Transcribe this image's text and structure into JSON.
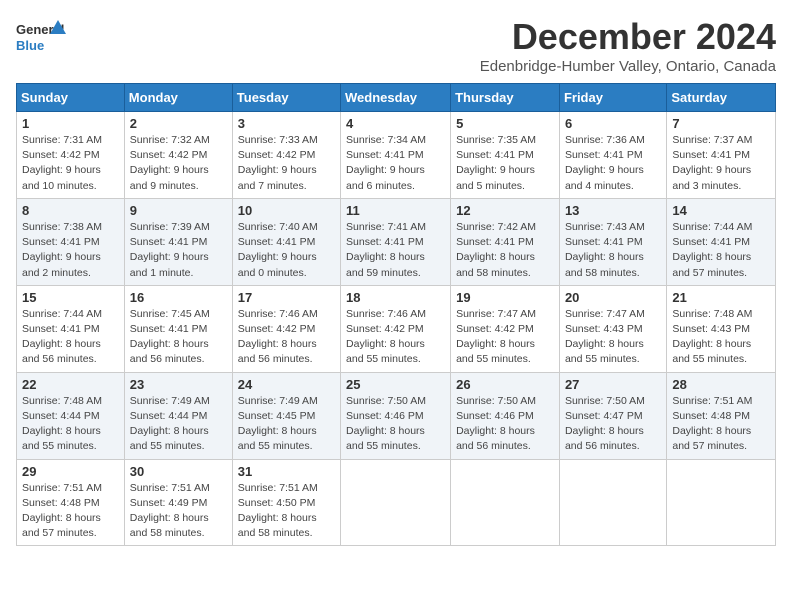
{
  "logo": {
    "line1": "General",
    "line2": "Blue"
  },
  "title": "December 2024",
  "location": "Edenbridge-Humber Valley, Ontario, Canada",
  "header": {
    "colors": {
      "accent": "#2b7dc2"
    }
  },
  "columns": [
    "Sunday",
    "Monday",
    "Tuesday",
    "Wednesday",
    "Thursday",
    "Friday",
    "Saturday"
  ],
  "weeks": [
    [
      {
        "day": "1",
        "detail": "Sunrise: 7:31 AM\nSunset: 4:42 PM\nDaylight: 9 hours and 10 minutes."
      },
      {
        "day": "2",
        "detail": "Sunrise: 7:32 AM\nSunset: 4:42 PM\nDaylight: 9 hours and 9 minutes."
      },
      {
        "day": "3",
        "detail": "Sunrise: 7:33 AM\nSunset: 4:42 PM\nDaylight: 9 hours and 7 minutes."
      },
      {
        "day": "4",
        "detail": "Sunrise: 7:34 AM\nSunset: 4:41 PM\nDaylight: 9 hours and 6 minutes."
      },
      {
        "day": "5",
        "detail": "Sunrise: 7:35 AM\nSunset: 4:41 PM\nDaylight: 9 hours and 5 minutes."
      },
      {
        "day": "6",
        "detail": "Sunrise: 7:36 AM\nSunset: 4:41 PM\nDaylight: 9 hours and 4 minutes."
      },
      {
        "day": "7",
        "detail": "Sunrise: 7:37 AM\nSunset: 4:41 PM\nDaylight: 9 hours and 3 minutes."
      }
    ],
    [
      {
        "day": "8",
        "detail": "Sunrise: 7:38 AM\nSunset: 4:41 PM\nDaylight: 9 hours and 2 minutes."
      },
      {
        "day": "9",
        "detail": "Sunrise: 7:39 AM\nSunset: 4:41 PM\nDaylight: 9 hours and 1 minute."
      },
      {
        "day": "10",
        "detail": "Sunrise: 7:40 AM\nSunset: 4:41 PM\nDaylight: 9 hours and 0 minutes."
      },
      {
        "day": "11",
        "detail": "Sunrise: 7:41 AM\nSunset: 4:41 PM\nDaylight: 8 hours and 59 minutes."
      },
      {
        "day": "12",
        "detail": "Sunrise: 7:42 AM\nSunset: 4:41 PM\nDaylight: 8 hours and 58 minutes."
      },
      {
        "day": "13",
        "detail": "Sunrise: 7:43 AM\nSunset: 4:41 PM\nDaylight: 8 hours and 58 minutes."
      },
      {
        "day": "14",
        "detail": "Sunrise: 7:44 AM\nSunset: 4:41 PM\nDaylight: 8 hours and 57 minutes."
      }
    ],
    [
      {
        "day": "15",
        "detail": "Sunrise: 7:44 AM\nSunset: 4:41 PM\nDaylight: 8 hours and 56 minutes."
      },
      {
        "day": "16",
        "detail": "Sunrise: 7:45 AM\nSunset: 4:41 PM\nDaylight: 8 hours and 56 minutes."
      },
      {
        "day": "17",
        "detail": "Sunrise: 7:46 AM\nSunset: 4:42 PM\nDaylight: 8 hours and 56 minutes."
      },
      {
        "day": "18",
        "detail": "Sunrise: 7:46 AM\nSunset: 4:42 PM\nDaylight: 8 hours and 55 minutes."
      },
      {
        "day": "19",
        "detail": "Sunrise: 7:47 AM\nSunset: 4:42 PM\nDaylight: 8 hours and 55 minutes."
      },
      {
        "day": "20",
        "detail": "Sunrise: 7:47 AM\nSunset: 4:43 PM\nDaylight: 8 hours and 55 minutes."
      },
      {
        "day": "21",
        "detail": "Sunrise: 7:48 AM\nSunset: 4:43 PM\nDaylight: 8 hours and 55 minutes."
      }
    ],
    [
      {
        "day": "22",
        "detail": "Sunrise: 7:48 AM\nSunset: 4:44 PM\nDaylight: 8 hours and 55 minutes."
      },
      {
        "day": "23",
        "detail": "Sunrise: 7:49 AM\nSunset: 4:44 PM\nDaylight: 8 hours and 55 minutes."
      },
      {
        "day": "24",
        "detail": "Sunrise: 7:49 AM\nSunset: 4:45 PM\nDaylight: 8 hours and 55 minutes."
      },
      {
        "day": "25",
        "detail": "Sunrise: 7:50 AM\nSunset: 4:46 PM\nDaylight: 8 hours and 55 minutes."
      },
      {
        "day": "26",
        "detail": "Sunrise: 7:50 AM\nSunset: 4:46 PM\nDaylight: 8 hours and 56 minutes."
      },
      {
        "day": "27",
        "detail": "Sunrise: 7:50 AM\nSunset: 4:47 PM\nDaylight: 8 hours and 56 minutes."
      },
      {
        "day": "28",
        "detail": "Sunrise: 7:51 AM\nSunset: 4:48 PM\nDaylight: 8 hours and 57 minutes."
      }
    ],
    [
      {
        "day": "29",
        "detail": "Sunrise: 7:51 AM\nSunset: 4:48 PM\nDaylight: 8 hours and 57 minutes."
      },
      {
        "day": "30",
        "detail": "Sunrise: 7:51 AM\nSunset: 4:49 PM\nDaylight: 8 hours and 58 minutes."
      },
      {
        "day": "31",
        "detail": "Sunrise: 7:51 AM\nSunset: 4:50 PM\nDaylight: 8 hours and 58 minutes."
      },
      null,
      null,
      null,
      null
    ]
  ]
}
